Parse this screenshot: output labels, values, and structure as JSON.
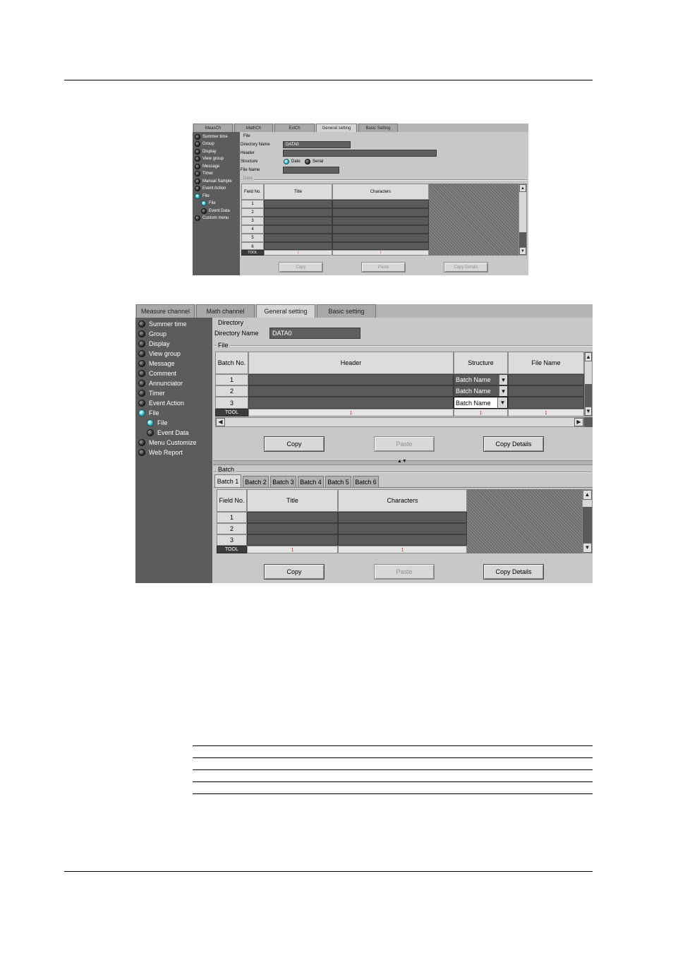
{
  "top": {
    "tabs": [
      "MeasCh",
      "MathCh",
      "ExtCh",
      "General setting",
      "Basic Setting"
    ],
    "active_tab": "General setting",
    "nav": [
      "Summer time",
      "Group",
      "Display",
      "View group",
      "Message",
      "Timer",
      "Manual Sample",
      "Event Action",
      "File",
      "File",
      "Event Data",
      "Custom menu"
    ],
    "file_heading": "File",
    "directory_label": "Directory Name",
    "directory_value": "DATA0",
    "header_label": "Header",
    "structure_label": "Structure",
    "structure_options": [
      "Date",
      "Serial"
    ],
    "filename_label": "File Name",
    "data_group": "Data",
    "columns": [
      "Field No.",
      "Title",
      "Characters"
    ],
    "rows": [
      "1",
      "2",
      "3",
      "4",
      "5",
      "6"
    ],
    "tool_label": "TOOL",
    "buttons": [
      "Copy",
      "Paste",
      "Copy Details"
    ]
  },
  "bottom": {
    "tabs": [
      "Measure channel",
      "Math channel",
      "General setting",
      "Basic setting"
    ],
    "active_tab": "General setting",
    "nav": [
      "Summer time",
      "Group",
      "Display",
      "View group",
      "Message",
      "Comment",
      "Annunciator",
      "Timer",
      "Event Action",
      "File",
      "File",
      "Event Data",
      "Menu Customize",
      "Web Report"
    ],
    "directory_heading": "Directory",
    "directory_label": "Directory Name",
    "directory_value": "DATA0",
    "file_group": "File",
    "file_columns": [
      "Batch No.",
      "Header",
      "Structure",
      "File Name"
    ],
    "file_rows": [
      "1",
      "2",
      "3"
    ],
    "structure_value": "Batch Name",
    "tool_label": "TOOL",
    "buttons": [
      "Copy",
      "Paste",
      "Copy Details"
    ],
    "batch_group": "Batch",
    "batch_tabs": [
      "Batch 1",
      "Batch 2",
      "Batch 3",
      "Batch 4",
      "Batch 5",
      "Batch 6"
    ],
    "batch_columns": [
      "Field No.",
      "Title",
      "Characters"
    ],
    "batch_rows": [
      "1",
      "2",
      "3"
    ],
    "buttons2": [
      "Copy",
      "Paste",
      "Copy Details"
    ]
  },
  "glyphs": {
    "tool_arrow": "↕",
    "scroll_up": "▲",
    "scroll_down": "▼",
    "scroll_left": "◀",
    "scroll_right": "▶",
    "dropdown": "▾",
    "splitter": "▲▼"
  },
  "colors": {
    "sidebar": "#5c5c5c",
    "radio_on": "#1aa7b8",
    "cell_dark": "#5a5a5a",
    "tool_arrow": "#c00000"
  }
}
